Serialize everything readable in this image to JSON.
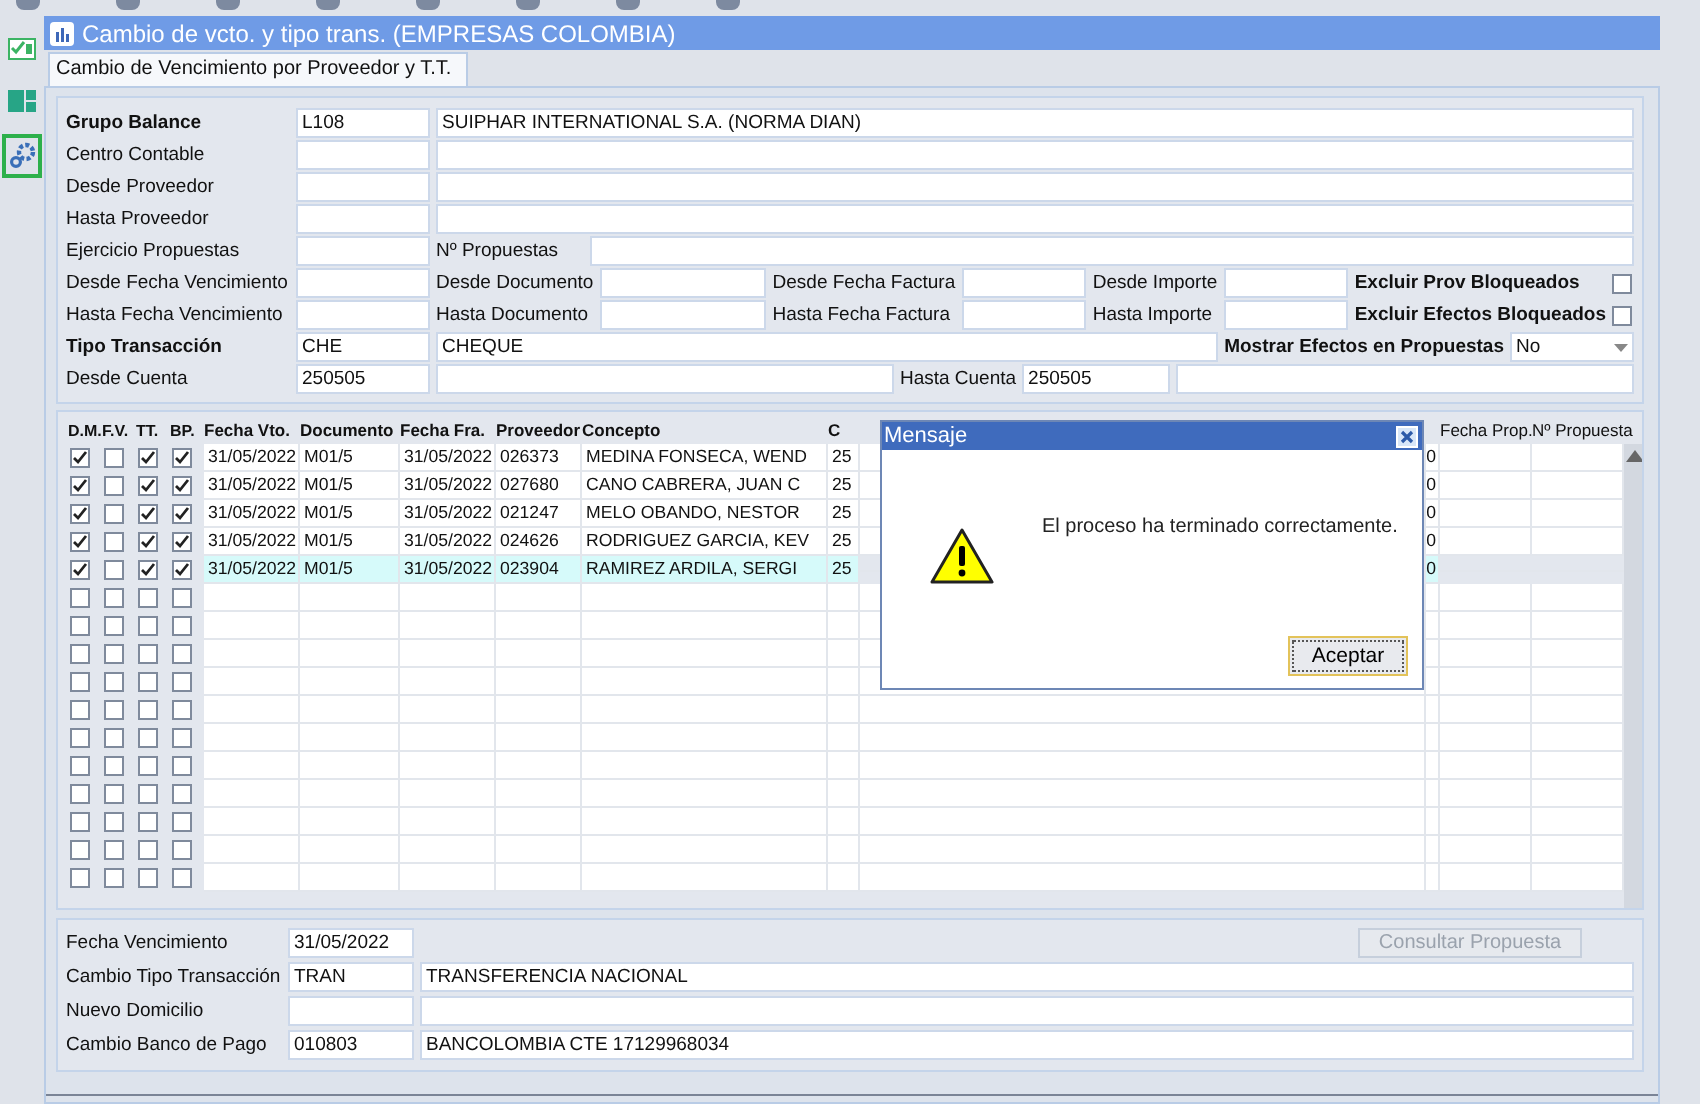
{
  "window": {
    "title": "Cambio de vcto. y tipo trans. (EMPRESAS COLOMBIA)"
  },
  "side_tools": [
    {
      "kind": "check",
      "selected": false
    },
    {
      "kind": "grid",
      "selected": false
    },
    {
      "kind": "gears",
      "selected": true
    }
  ],
  "tabs": [
    {
      "label": "Cambio de Vencimiento por Proveedor y T.T.",
      "selected": true
    }
  ],
  "form": {
    "rows": [
      {
        "items": [
          {
            "kind": "bold_label",
            "text": "Grupo Balance"
          },
          {
            "kind": "field",
            "value": "L108"
          },
          {
            "kind": "field",
            "value": "SUIPHAR INTERNATIONAL S.A. (NORMA DIAN)"
          }
        ]
      },
      {
        "items": [
          {
            "kind": "label",
            "text": "Centro Contable"
          },
          {
            "kind": "field"
          },
          {
            "kind": "field"
          }
        ]
      },
      {
        "items": [
          {
            "kind": "label",
            "text": "Desde Proveedor"
          },
          {
            "kind": "field"
          },
          {
            "kind": "field"
          }
        ]
      },
      {
        "items": [
          {
            "kind": "label",
            "text": "Hasta Proveedor"
          },
          {
            "kind": "field"
          },
          {
            "kind": "field"
          }
        ]
      },
      {
        "items": [
          {
            "kind": "label",
            "text": "Ejercicio Propuestas"
          },
          {
            "kind": "field"
          },
          {
            "kind": "label",
            "text": "Nº Propuestas"
          },
          {
            "kind": "field"
          }
        ]
      },
      {
        "items": [
          {
            "kind": "label",
            "text": "Desde Fecha Vencimiento"
          },
          {
            "kind": "field"
          },
          {
            "kind": "label",
            "text": "Desde Documento"
          },
          {
            "kind": "field"
          },
          {
            "kind": "label",
            "text": "Desde Fecha Factura"
          },
          {
            "kind": "field"
          },
          {
            "kind": "label",
            "text": "Desde Importe"
          },
          {
            "kind": "field"
          },
          {
            "kind": "bold_label",
            "text": "Excluir Prov Bloqueados"
          },
          {
            "kind": "checkbox",
            "checked": false
          }
        ]
      },
      {
        "items": [
          {
            "kind": "label",
            "text": "Hasta Fecha Vencimiento"
          },
          {
            "kind": "field"
          },
          {
            "kind": "label",
            "text": "Hasta Documento"
          },
          {
            "kind": "field"
          },
          {
            "kind": "label",
            "text": "Hasta Fecha Factura"
          },
          {
            "kind": "field"
          },
          {
            "kind": "label",
            "text": "Hasta Importe"
          },
          {
            "kind": "field"
          },
          {
            "kind": "bold_label",
            "text": "Excluir Efectos Bloqueados"
          },
          {
            "kind": "checkbox",
            "checked": false
          }
        ]
      },
      {
        "items": [
          {
            "kind": "bold_label",
            "text": "Tipo Transacción"
          },
          {
            "kind": "field",
            "value": "CHE"
          },
          {
            "kind": "field",
            "value": "CHEQUE"
          },
          {
            "kind": "bold_label",
            "text": "Mostrar Efectos en Propuestas"
          },
          {
            "kind": "select",
            "value": "No"
          }
        ]
      },
      {
        "items": [
          {
            "kind": "label",
            "text": "Desde Cuenta"
          },
          {
            "kind": "field",
            "value": "250505"
          },
          {
            "kind": "field"
          },
          {
            "kind": "label",
            "text": "Hasta Cuenta"
          },
          {
            "kind": "field",
            "value": "250505"
          },
          {
            "kind": "field"
          }
        ]
      }
    ]
  },
  "table": {
    "check_headers": [
      "D.M.",
      "F.V.",
      "TT.",
      "BP."
    ],
    "headers": {
      "fecha_vto": "Fecha Vto.",
      "documento": "Documento",
      "fecha_fra": "Fecha Fra.",
      "proveedor": "Proveedor",
      "concepto": "Concepto",
      "column_7": "C",
      "fecha_prop": "Fecha Prop.",
      "n_propuesta": "Nº Propuesta"
    },
    "rows": [
      {
        "checks": [
          true,
          false,
          true,
          true
        ],
        "fecha_vto": "31/05/2022",
        "documento": "M01/5",
        "fecha_fra": "31/05/2022",
        "proveedor": "026373",
        "concepto": "MEDINA FONSECA, WEND",
        "column_7": "25",
        "column_8": "0",
        "selected": false
      },
      {
        "checks": [
          true,
          false,
          true,
          true
        ],
        "fecha_vto": "31/05/2022",
        "documento": "M01/5",
        "fecha_fra": "31/05/2022",
        "proveedor": "027680",
        "concepto": "CANO CABRERA, JUAN C",
        "column_7": "25",
        "column_8": "0",
        "selected": false
      },
      {
        "checks": [
          true,
          false,
          true,
          true
        ],
        "fecha_vto": "31/05/2022",
        "documento": "M01/5",
        "fecha_fra": "31/05/2022",
        "proveedor": "021247",
        "concepto": "MELO OBANDO, NESTOR",
        "column_7": "25",
        "column_8": "0",
        "selected": false
      },
      {
        "checks": [
          true,
          false,
          true,
          true
        ],
        "fecha_vto": "31/05/2022",
        "documento": "M01/5",
        "fecha_fra": "31/05/2022",
        "proveedor": "024626",
        "concepto": "RODRIGUEZ GARCIA, KEV",
        "column_7": "25",
        "column_8": "0",
        "selected": false
      },
      {
        "checks": [
          true,
          false,
          true,
          true
        ],
        "fecha_vto": "31/05/2022",
        "documento": "M01/5",
        "fecha_fra": "31/05/2022",
        "proveedor": "023904",
        "concepto": "RAMIREZ ARDILA, SERGI",
        "column_7": "25",
        "column_8": "0",
        "selected": true
      },
      {
        "checks": [
          false,
          false,
          false,
          false
        ],
        "selected": false
      },
      {
        "checks": [
          false,
          false,
          false,
          false
        ],
        "selected": false
      },
      {
        "checks": [
          false,
          false,
          false,
          false
        ],
        "selected": false
      },
      {
        "checks": [
          false,
          false,
          false,
          false
        ],
        "selected": false
      },
      {
        "checks": [
          false,
          false,
          false,
          false
        ],
        "selected": false
      },
      {
        "checks": [
          false,
          false,
          false,
          false
        ],
        "selected": false
      },
      {
        "checks": [
          false,
          false,
          false,
          false
        ],
        "selected": false
      },
      {
        "checks": [
          false,
          false,
          false,
          false
        ],
        "selected": false
      },
      {
        "checks": [
          false,
          false,
          false,
          false
        ],
        "selected": false
      },
      {
        "checks": [
          false,
          false,
          false,
          false
        ],
        "selected": false
      },
      {
        "checks": [
          false,
          false,
          false,
          false
        ],
        "selected": false
      }
    ]
  },
  "bottom": {
    "rows": [
      {
        "label": "Fecha Vencimiento",
        "code": "31/05/2022"
      },
      {
        "label": "Cambio Tipo Transacción",
        "code": "TRAN",
        "name": "TRANSFERENCIA NACIONAL"
      },
      {
        "label": "Nuevo Domicilio"
      },
      {
        "label": "Cambio Banco de Pago",
        "code": "010803",
        "name": "BANCOLOMBIA CTE 17129968034"
      }
    ],
    "button": {
      "label": "Consultar Propuesta",
      "disabled": true
    }
  },
  "dialog": {
    "title": "Mensaje",
    "message": "El proceso ha terminado correctamente.",
    "button": "Aceptar"
  }
}
